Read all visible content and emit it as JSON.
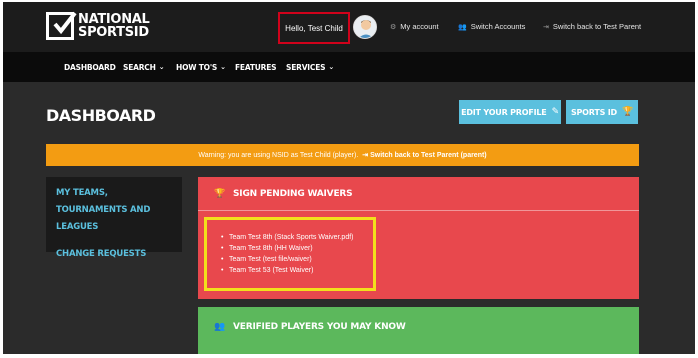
{
  "brand": {
    "line1": "NATIONAL",
    "line2": "SPORTSID"
  },
  "top_links": {
    "hello": "Hello, Test Child",
    "my_account": "My account",
    "switch_accounts": "Switch Accounts",
    "switch_back": "Switch back to Test Parent"
  },
  "nav": {
    "items": [
      {
        "label": "DASHBOARD"
      },
      {
        "label": "SEARCH"
      },
      {
        "label": "HOW TO'S"
      },
      {
        "label": "FEATURES"
      },
      {
        "label": "SERVICES"
      }
    ]
  },
  "page": {
    "title": "DASHBOARD",
    "edit_profile": "EDIT YOUR PROFILE",
    "sports_id": "SPORTS ID"
  },
  "warning": {
    "text": "Warning: you are using NSID as Test Child (player).",
    "link": "Switch back to Test Parent (parent)"
  },
  "sidebar": {
    "items": [
      {
        "label": "MY TEAMS, TOURNAMENTS AND LEAGUES"
      },
      {
        "label": "CHANGE REQUESTS"
      }
    ]
  },
  "waivers": {
    "title": "SIGN PENDING WAIVERS",
    "items": [
      "Team Test 8th (Stack Sports Waiver.pdf)",
      "Team Test 8th (HH Waiver)",
      "Team Test (test file/waiver)",
      "Team Test 53 (Test Waiver)"
    ]
  },
  "verified": {
    "title": "VERIFIED PLAYERS YOU MAY KNOW"
  },
  "colors": {
    "accent_blue": "#5bc0de",
    "warning_orange": "#f39c12",
    "waiver_red": "#e8484d",
    "verified_green": "#5cb85c",
    "highlight_red": "#d0021b",
    "highlight_yellow": "#f2e01c"
  }
}
